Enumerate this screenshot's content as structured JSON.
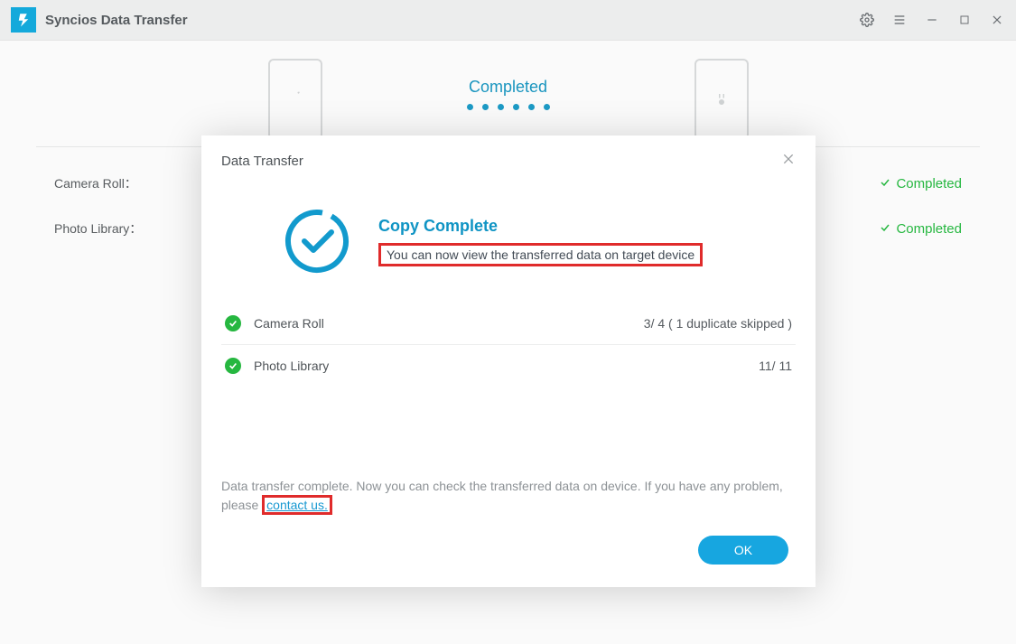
{
  "app": {
    "title": "Syncios Data Transfer"
  },
  "header": {
    "status": "Completed"
  },
  "background_rows": [
    {
      "label": "Camera Roll：",
      "status": "Completed"
    },
    {
      "label": "Photo Library：",
      "status": "Completed"
    }
  ],
  "dialog": {
    "title": "Data Transfer",
    "copy_heading": "Copy Complete",
    "copy_sub": "You can now view the transferred data on target device",
    "items": [
      {
        "name": "Camera Roll",
        "result": "3/ 4 ( 1 duplicate skipped )"
      },
      {
        "name": "Photo Library",
        "result": "11/ 11"
      }
    ],
    "footer_pre": "Data transfer complete. Now you can check the transferred data on device. If you have any problem, please ",
    "footer_link": "contact us.",
    "ok": "OK"
  }
}
